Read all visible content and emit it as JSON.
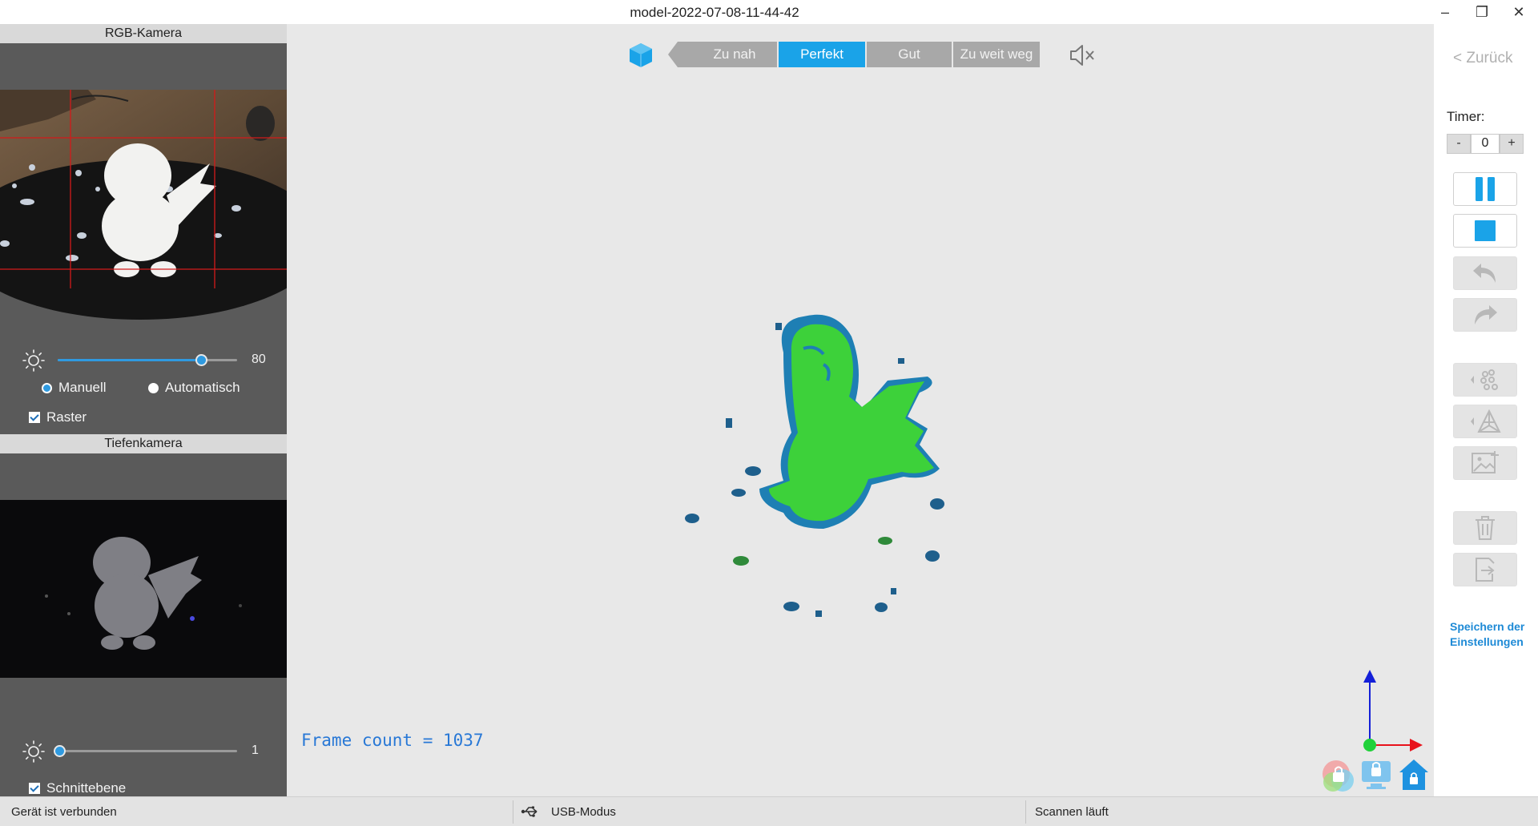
{
  "window": {
    "title": "model-2022-07-08-11-44-42",
    "minimize": "–",
    "maximize": "❐",
    "close": "✕"
  },
  "rgb_camera": {
    "header": "RGB-Kamera",
    "brightness": 80,
    "brightness_label": "80",
    "mode_manual": "Manuell",
    "mode_auto": "Automatisch",
    "mode_selected": "Manuell",
    "grid_label": "Raster",
    "grid_checked": true
  },
  "depth_camera": {
    "header": "Tiefenkamera",
    "brightness": 1,
    "brightness_label": "1",
    "section_plane_label": "Schnittebene",
    "section_plane_checked": true
  },
  "distance_indicator": {
    "options": [
      "Zu nah",
      "Perfekt",
      "Gut",
      "Zu weit weg"
    ],
    "selected": "Perfekt"
  },
  "viewport": {
    "frame_count_text": "Frame count = 1037",
    "mute_icon": "speaker-muted-icon",
    "axis_colors": {
      "x": "#e8121b",
      "y": "#1420d8",
      "z": "#21d13a"
    }
  },
  "right_panel": {
    "back_label": "< Zurück",
    "timer_label": "Timer:",
    "timer_minus": "-",
    "timer_value": "0",
    "timer_plus": "+",
    "save_settings_label": "Speichern der Einstellungen"
  },
  "status_bar": {
    "device": "Gerät ist verbunden",
    "mode": "USB-Modus",
    "state": "Scannen läuft"
  },
  "colors": {
    "accent": "#1aa3e8",
    "mesh_green": "#3dd13a",
    "mesh_blue": "#1e7fb4"
  }
}
